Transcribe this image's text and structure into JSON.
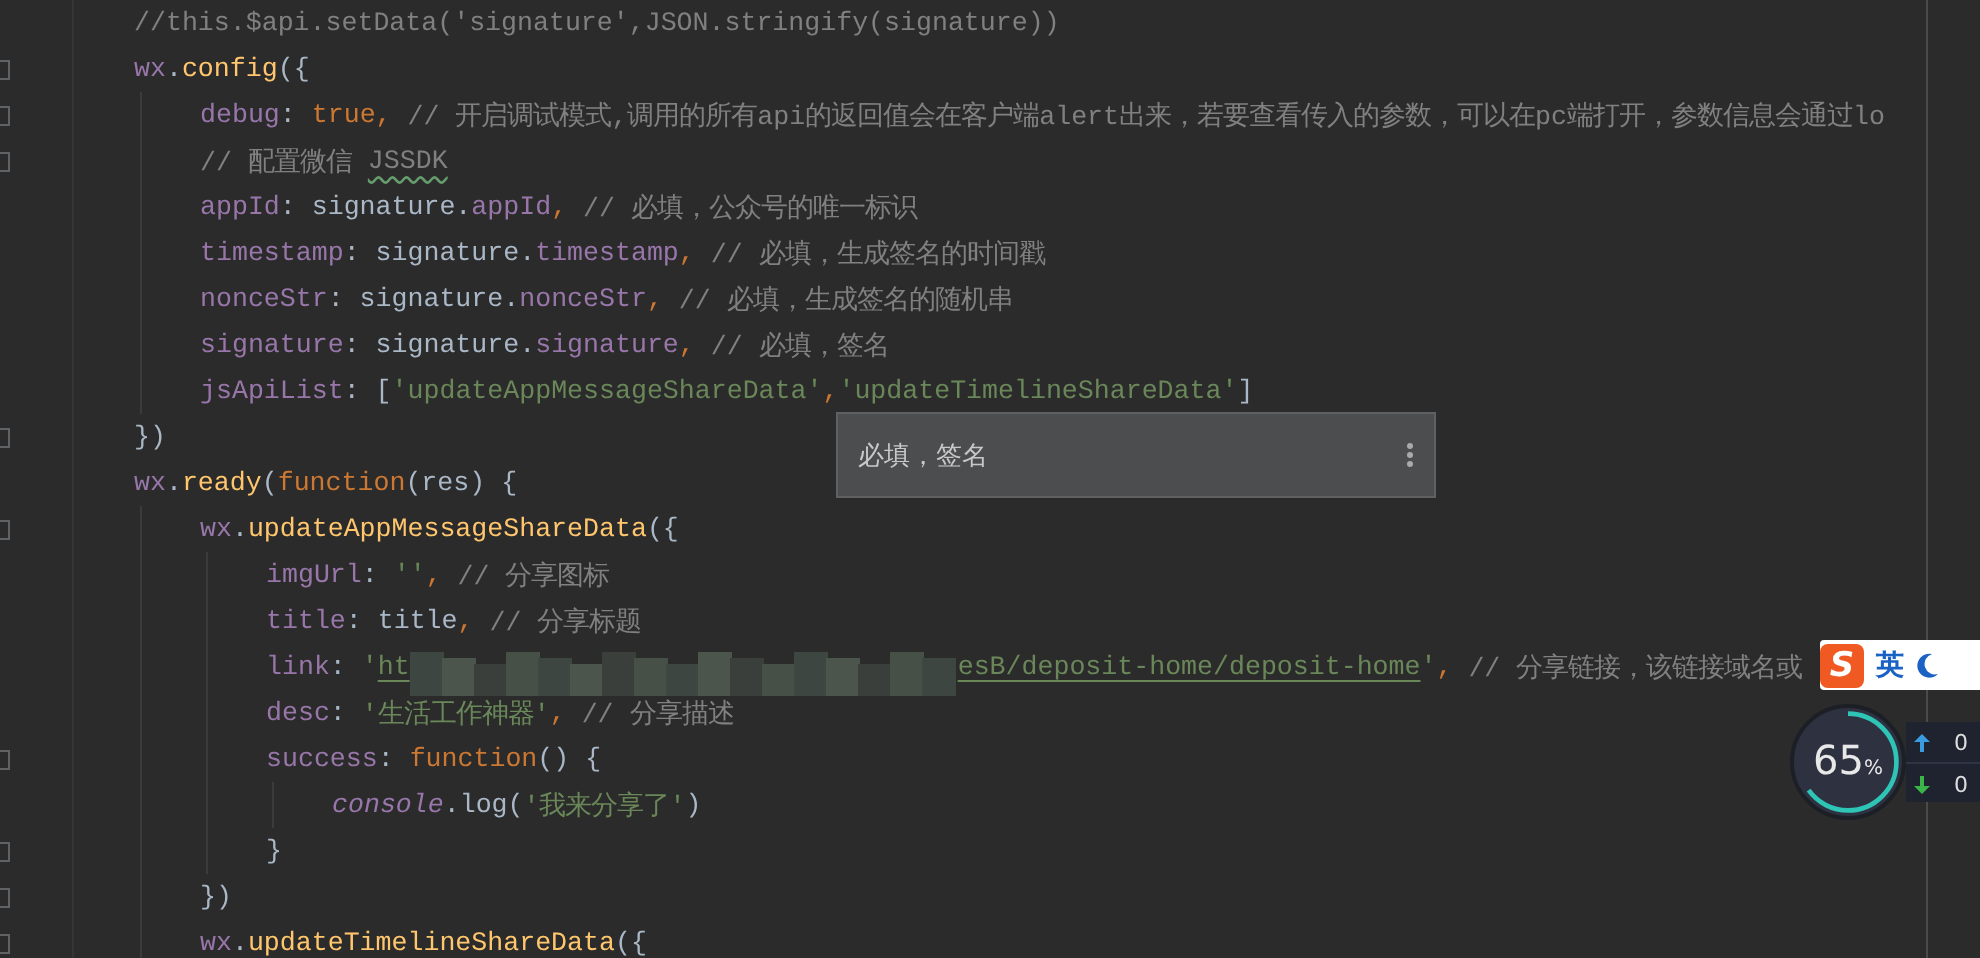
{
  "editor": {
    "lines": [
      {
        "fold": false,
        "tokens": [
          {
            "kind": "comment",
            "text": "//this.$api.setData('signature',JSON.stringify(signature))"
          }
        ]
      },
      {
        "fold": true,
        "tokens": [
          {
            "kind": "prop",
            "text": "wx"
          },
          {
            "kind": "plain",
            "text": "."
          },
          {
            "kind": "func",
            "text": "config"
          },
          {
            "kind": "plain",
            "text": "({"
          }
        ],
        "children": [
          {
            "fold": true,
            "tokens": [
              {
                "kind": "prop",
                "text": "debug"
              },
              {
                "kind": "plain",
                "text": ": "
              },
              {
                "kind": "keyword",
                "text": "true, "
              },
              {
                "kind": "comment",
                "text": "// 开启调试模式,调用的所有api的返回值会在客户端alert出来，若要查看传入的参数，可以在pc端打开，参数信息会通过lo"
              }
            ]
          },
          {
            "fold": true,
            "tokens": [
              {
                "kind": "comment",
                "text": "// 配置微信 "
              },
              {
                "kind": "typo",
                "text": "JSSDK"
              }
            ]
          },
          {
            "fold": false,
            "tokens": [
              {
                "kind": "prop",
                "text": "appId"
              },
              {
                "kind": "plain",
                "text": ": signature."
              },
              {
                "kind": "prop",
                "text": "appId"
              },
              {
                "kind": "keyword",
                "text": ", "
              },
              {
                "kind": "comment",
                "text": "// 必填，公众号的唯一标识"
              }
            ]
          },
          {
            "fold": false,
            "tokens": [
              {
                "kind": "prop",
                "text": "timestamp"
              },
              {
                "kind": "plain",
                "text": ": signature."
              },
              {
                "kind": "prop",
                "text": "timestamp"
              },
              {
                "kind": "keyword",
                "text": ", "
              },
              {
                "kind": "comment",
                "text": "// 必填，生成签名的时间戳"
              }
            ]
          },
          {
            "fold": false,
            "tokens": [
              {
                "kind": "prop",
                "text": "nonceStr"
              },
              {
                "kind": "plain",
                "text": ": signature."
              },
              {
                "kind": "prop",
                "text": "nonceStr"
              },
              {
                "kind": "keyword",
                "text": ", "
              },
              {
                "kind": "comment",
                "text": "// 必填，生成签名的随机串"
              }
            ]
          },
          {
            "fold": false,
            "tokens": [
              {
                "kind": "prop",
                "text": "signature"
              },
              {
                "kind": "plain",
                "text": ": signature."
              },
              {
                "kind": "prop",
                "text": "signature"
              },
              {
                "kind": "keyword",
                "text": ", "
              },
              {
                "kind": "comment",
                "text": "// 必填，签名"
              }
            ]
          },
          {
            "fold": false,
            "tokens": [
              {
                "kind": "prop",
                "text": "jsApiList"
              },
              {
                "kind": "plain",
                "text": ": ["
              },
              {
                "kind": "string",
                "text": "'updateAppMessageShareData'"
              },
              {
                "kind": "keyword",
                "text": ","
              },
              {
                "kind": "string",
                "text": "'updateTimelineShareData'"
              },
              {
                "kind": "plain",
                "text": "]"
              }
            ]
          }
        ]
      },
      {
        "fold": true,
        "tokens": [
          {
            "kind": "plain",
            "text": "})"
          }
        ]
      },
      {
        "fold": false,
        "tokens": [
          {
            "kind": "prop",
            "text": "wx"
          },
          {
            "kind": "plain",
            "text": "."
          },
          {
            "kind": "func",
            "text": "ready"
          },
          {
            "kind": "plain",
            "text": "("
          },
          {
            "kind": "keyword",
            "text": "function"
          },
          {
            "kind": "plain",
            "text": "(res) {"
          }
        ],
        "children": [
          {
            "fold": true,
            "tokens": [
              {
                "kind": "prop",
                "text": "wx"
              },
              {
                "kind": "plain",
                "text": "."
              },
              {
                "kind": "func",
                "text": "updateAppMessageShareData"
              },
              {
                "kind": "plain",
                "text": "({"
              }
            ],
            "children": [
              {
                "fold": false,
                "tokens": [
                  {
                    "kind": "prop",
                    "text": "imgUrl"
                  },
                  {
                    "kind": "plain",
                    "text": ": "
                  },
                  {
                    "kind": "string",
                    "text": "''"
                  },
                  {
                    "kind": "keyword",
                    "text": ", "
                  },
                  {
                    "kind": "comment",
                    "text": "// 分享图标"
                  }
                ]
              },
              {
                "fold": false,
                "tokens": [
                  {
                    "kind": "prop",
                    "text": "title"
                  },
                  {
                    "kind": "plain",
                    "text": ": title"
                  },
                  {
                    "kind": "keyword",
                    "text": ", "
                  },
                  {
                    "kind": "comment",
                    "text": "// 分享标题"
                  }
                ]
              },
              {
                "fold": false,
                "tokens": [
                  {
                    "kind": "prop",
                    "text": "link"
                  },
                  {
                    "kind": "plain",
                    "text": ": "
                  },
                  {
                    "kind": "string",
                    "text": "'"
                  },
                  {
                    "kind": "link",
                    "text": "ht"
                  },
                  {
                    "kind": "redacted"
                  },
                  {
                    "kind": "link",
                    "text": "esB/deposit-home/deposit-home"
                  },
                  {
                    "kind": "string",
                    "text": "'"
                  },
                  {
                    "kind": "keyword",
                    "text": ", "
                  },
                  {
                    "kind": "comment",
                    "text": "// 分享链接，该链接域名或"
                  }
                ]
              },
              {
                "fold": false,
                "tokens": [
                  {
                    "kind": "prop",
                    "text": "desc"
                  },
                  {
                    "kind": "plain",
                    "text": ": "
                  },
                  {
                    "kind": "string",
                    "text": "'生活工作神器'"
                  },
                  {
                    "kind": "keyword",
                    "text": ", "
                  },
                  {
                    "kind": "comment",
                    "text": "// 分享描述"
                  }
                ]
              },
              {
                "fold": true,
                "tokens": [
                  {
                    "kind": "prop",
                    "text": "success"
                  },
                  {
                    "kind": "plain",
                    "text": ": "
                  },
                  {
                    "kind": "keyword",
                    "text": "function"
                  },
                  {
                    "kind": "plain",
                    "text": "() {"
                  }
                ],
                "children": [
                  {
                    "fold": false,
                    "tokens": [
                      {
                        "kind": "italic",
                        "text": "console"
                      },
                      {
                        "kind": "plain",
                        "text": ".log("
                      },
                      {
                        "kind": "string",
                        "text": "'我来分享了'"
                      },
                      {
                        "kind": "plain",
                        "text": ")"
                      }
                    ]
                  }
                ]
              },
              {
                "fold": true,
                "tokens": [
                  {
                    "kind": "plain",
                    "text": "}"
                  }
                ]
              }
            ]
          },
          {
            "fold": true,
            "tokens": [
              {
                "kind": "plain",
                "text": "})"
              }
            ]
          },
          {
            "fold": true,
            "tokens": [
              {
                "kind": "prop",
                "text": "wx"
              },
              {
                "kind": "plain",
                "text": "."
              },
              {
                "kind": "func",
                "text": "updateTimelineShareData"
              },
              {
                "kind": "plain",
                "text": "({"
              }
            ]
          }
        ]
      }
    ]
  },
  "tooltip": {
    "text": "必填，签名"
  },
  "ime_toolbar": {
    "logo": "S",
    "mode": "英"
  },
  "system_monitor": {
    "usage": "65",
    "unit": "%",
    "upload": "0",
    "download": "0"
  }
}
